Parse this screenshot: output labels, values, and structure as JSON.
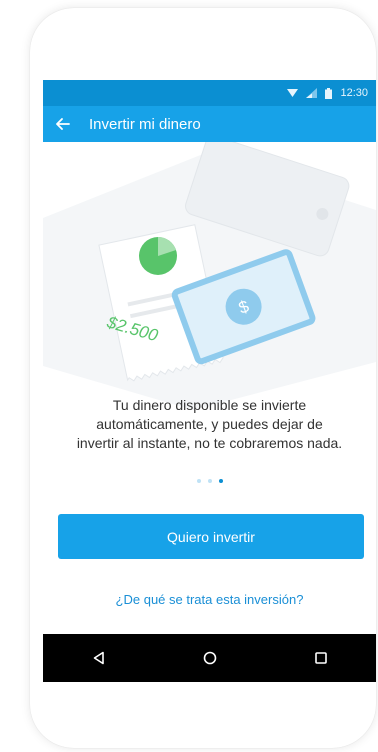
{
  "status_bar": {
    "time": "12:30",
    "icons": [
      "wifi-icon",
      "signal-icon",
      "battery-icon"
    ]
  },
  "app_bar": {
    "title": "Invertir mi dinero",
    "back_icon": "arrow-left-icon"
  },
  "illustration": {
    "receipt_amount": "$2.500",
    "banknote_symbol": "$"
  },
  "description": {
    "line1": "Tu dinero disponible se invierte",
    "line2": "automáticamente, y puedes dejar de",
    "line3": "invertir al instante, no te cobraremos nada."
  },
  "pager": {
    "total_pages": 3,
    "current_page": 3
  },
  "cta": {
    "label": "Quiero invertir"
  },
  "info_link": {
    "label": "¿De qué se trata esta inversión?"
  },
  "nav_bar": {
    "icons": [
      "nav-back-icon",
      "nav-home-icon",
      "nav-recents-icon"
    ]
  },
  "colors": {
    "primary": "#17a2e8",
    "status_bar": "#0b8fd2",
    "link": "#1a8fd6",
    "chart_green": "#58c46a"
  }
}
